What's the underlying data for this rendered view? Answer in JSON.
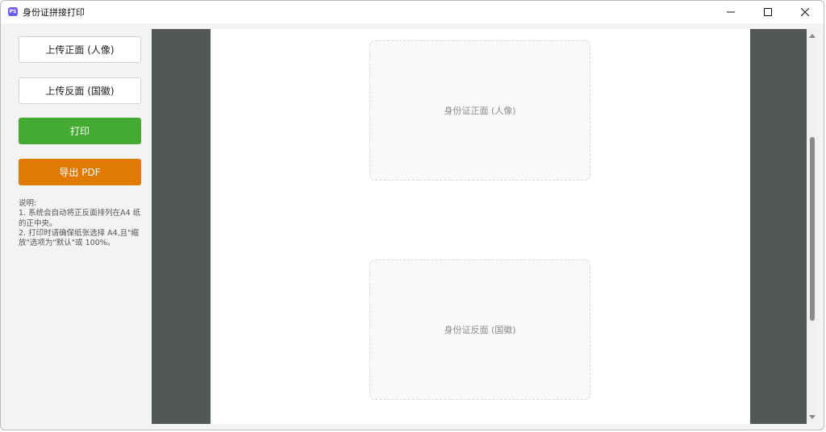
{
  "window": {
    "title": "身份证拼接打印",
    "icon_label": "PS"
  },
  "sidebar": {
    "upload_front_label": "上传正面 (人像)",
    "upload_back_label": "上传反面 (国徽)",
    "print_label": "打印",
    "export_pdf_label": "导出 PDF",
    "notes": "说明:\n1. 系统会自动将正反面排列在A4 纸的正中央。\n2. 打印时请确保纸张选择 A4,且\"缩放\"选项为\"默认\"或 100%。"
  },
  "preview": {
    "front_placeholder": "身份证正面 (人像)",
    "back_placeholder": "身份证反面 (国徽)"
  },
  "colors": {
    "print_button": "#45aa32",
    "export_button": "#e17a05",
    "preview_background": "#535758",
    "app_icon": "#6a5be8"
  },
  "icons": {
    "minimize": "minimize-icon",
    "maximize": "maximize-icon",
    "close": "close-icon",
    "scroll_up": "chevron-up-icon",
    "scroll_down": "chevron-down-icon"
  }
}
